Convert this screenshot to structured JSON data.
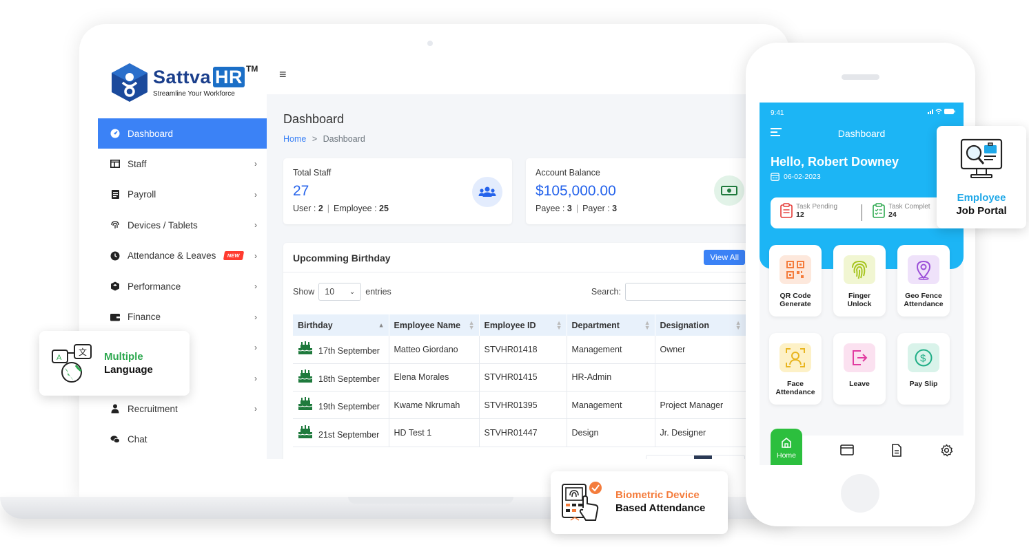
{
  "brand": {
    "name": "Sattva",
    "name_hr": "HR",
    "tm": "TM",
    "tagline": "Streamline Your Workforce"
  },
  "sidebar": {
    "items": [
      {
        "label": "Dashboard",
        "icon": "dashboard-icon",
        "active": true
      },
      {
        "label": "Staff",
        "icon": "staff-icon"
      },
      {
        "label": "Payroll",
        "icon": "payroll-icon"
      },
      {
        "label": "Devices / Tablets",
        "icon": "fingerprint-icon"
      },
      {
        "label": "Attendance & Leaves",
        "icon": "clock-icon",
        "badge": "NEW"
      },
      {
        "label": "Performance",
        "icon": "performance-icon"
      },
      {
        "label": "Finance",
        "icon": "finance-icon"
      },
      {
        "label": "",
        "icon": ""
      },
      {
        "label": "",
        "icon": ""
      },
      {
        "label": "Recruitment",
        "icon": "recruitment-icon"
      },
      {
        "label": "Chat",
        "icon": "chat-icon"
      }
    ]
  },
  "page": {
    "title": "Dashboard",
    "breadcrumb_home": "Home",
    "breadcrumb_sep": ">",
    "breadcrumb_current": "Dashboard"
  },
  "stats": {
    "staff": {
      "label": "Total Staff",
      "value": "27",
      "user_label": "User :",
      "user_value": "2",
      "employee_label": "Employee :",
      "employee_value": "25"
    },
    "balance": {
      "label": "Account Balance",
      "value": "$105,000.00",
      "payee_label": "Payee :",
      "payee_value": "3",
      "payer_label": "Payer :",
      "payer_value": "3"
    }
  },
  "birthday": {
    "title": "Upcomming Birthday",
    "view_all": "View All",
    "show_label": "Show",
    "show_value": "10",
    "entries_label": "entries",
    "search_label": "Search:",
    "columns": [
      "Birthday",
      "Employee Name",
      "Employee ID",
      "Department",
      "Designation"
    ],
    "rows": [
      [
        "17th September",
        "Matteo Giordano",
        "STVHR01418",
        "Management",
        "Owner"
      ],
      [
        "18th September",
        "Elena Morales",
        "STVHR01415",
        "HR-Admin",
        ""
      ],
      [
        "19th September",
        "Kwame Nkrumah",
        "STVHR01395",
        "Management",
        "Project Manager"
      ],
      [
        "21st September",
        "HD Test 1",
        "STVHR01447",
        "Design",
        "Jr. Designer"
      ]
    ]
  },
  "features": {
    "language": {
      "line1": "Multiple",
      "line2": "Language",
      "accent": "#2da84f"
    },
    "biometric": {
      "line1": "Biometric Device",
      "line2": "Based Attendance",
      "accent": "#f47c3c"
    },
    "portal": {
      "line1": "Employee",
      "line2": "Job Portal",
      "accent": "#1fa8e8"
    }
  },
  "phone": {
    "time": "9:41",
    "title": "Dashboard",
    "greeting": "Hello, Robert Downey",
    "date": "06-02-2023",
    "task_pending_label": "Task Pending",
    "task_pending_value": "12",
    "task_complete_label": "Task Complet",
    "task_complete_value": "24",
    "tiles": [
      {
        "line1": "QR Code",
        "line2": "Generate",
        "icon": "qr-code-icon",
        "color": "#f47c3c"
      },
      {
        "line1": "Finger",
        "line2": "Unlock",
        "icon": "fingerprint-icon",
        "color": "#b7d62b"
      },
      {
        "line1": "Geo Fence",
        "line2": "Attendance",
        "icon": "location-pin-icon",
        "color": "#9b4fd8"
      },
      {
        "line1": "Face",
        "line2": "Attendance",
        "icon": "face-scan-icon",
        "color": "#e8b520"
      },
      {
        "line1": "Leave",
        "line2": "",
        "icon": "exit-icon",
        "color": "#e13aa0"
      },
      {
        "line1": "Pay Slip",
        "line2": "",
        "icon": "dollar-icon",
        "color": "#1fae86"
      }
    ],
    "nav_home": "Home",
    "accent": "#1cb5f5"
  }
}
